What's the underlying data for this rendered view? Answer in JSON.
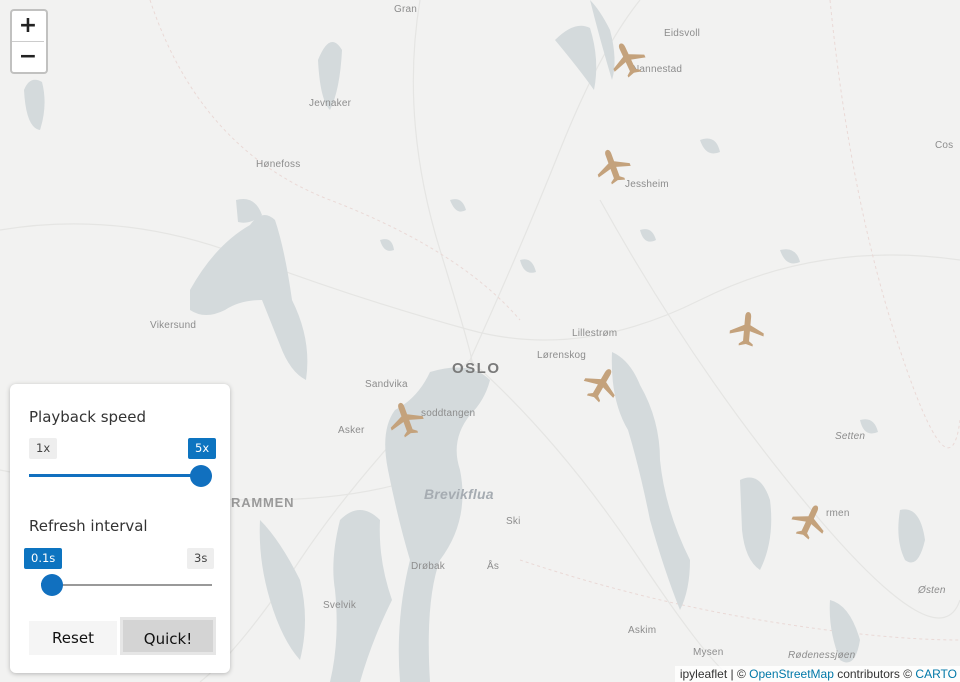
{
  "map": {
    "zoom_in_label": "+",
    "zoom_out_label": "−",
    "places": {
      "gran": "Gran",
      "eidsvoll": "Eidsvoll",
      "nannestad": "Nannestad",
      "jevnaker": "Jevnaker",
      "hønefoss": "Hønefoss",
      "jessheim": "Jessheim",
      "cos": "Cos",
      "vikersund": "Vikersund",
      "lillestrom": "Lillestrøm",
      "oslo": "OSLO",
      "lorenskog": "Lørenskog",
      "sandvika": "Sandvika",
      "nesoddtangen": "soddtangen",
      "asker": "Asker",
      "setten": "Setten",
      "drammen": "RAMMEN",
      "brevikflua": "Brevikflua",
      "ski": "Ski",
      "mysen_town": "Mysen",
      "morken": "rmen",
      "drobak": "Drøbak",
      "as": "Ås",
      "osten": "Østen",
      "svelvik": "Svelvik",
      "askim": "Askim",
      "mysen": "Mysen",
      "rodenessjoen": "Rødenessjøen"
    },
    "plane_color": "#c4a27c",
    "water_color": "#d4dadc",
    "land_color": "#f2f2f1",
    "planes": [
      {
        "name": "plane-1",
        "heading": -25
      },
      {
        "name": "plane-2",
        "heading": -20
      },
      {
        "name": "plane-3",
        "heading": 5
      },
      {
        "name": "plane-4",
        "heading": 30
      },
      {
        "name": "plane-5",
        "heading": -20
      },
      {
        "name": "plane-6",
        "heading": 25
      }
    ]
  },
  "controls": {
    "playback": {
      "label": "Playback speed",
      "min_label": "1x",
      "max_label": "5x",
      "value_fraction": 1.0
    },
    "refresh": {
      "label": "Refresh interval",
      "min_label": "0.1s",
      "max_label": "3s",
      "value_fraction": 0.0
    },
    "reset_label": "Reset",
    "quick_label": "Quick!",
    "accent_color": "#1170bf"
  },
  "attribution": {
    "prefix": "ipyleaflet",
    "sep": " | © ",
    "osm": "OpenStreetMap",
    "contrib": " contributors © ",
    "carto": "CARTO"
  }
}
